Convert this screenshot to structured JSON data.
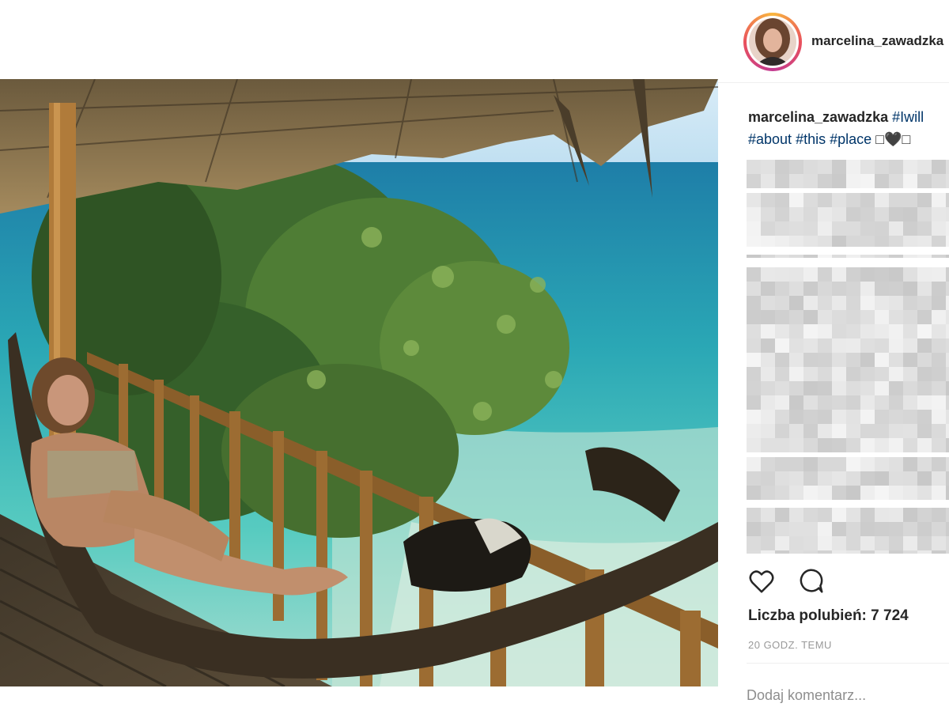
{
  "post": {
    "username": "marcelina_zawadzka",
    "caption": {
      "username": "marcelina_zawadzka",
      "tags_line1": [
        "#Iwill"
      ],
      "tags_line2": [
        "#about",
        "#this",
        "#place"
      ],
      "emoji": "□🖤□"
    },
    "likes_label": "Liczba polubień: 7 724",
    "timestamp": "20 GODZ. TEMU",
    "comment_placeholder": "Dodaj komentarz..."
  },
  "icons": {
    "like": "heart-icon",
    "comment": "comment-bubble-icon"
  },
  "colors": {
    "username_text": "#262626",
    "hashtag": "#003569",
    "muted": "#999999",
    "story_ring": [
      "#f9b73f",
      "#e9515c",
      "#c23991"
    ]
  }
}
